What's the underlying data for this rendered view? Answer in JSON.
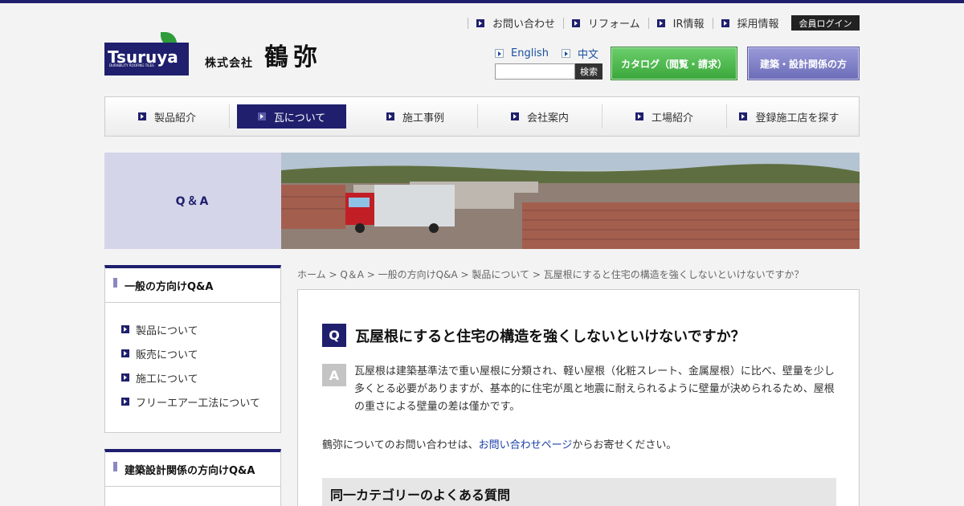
{
  "header": {
    "util_nav": [
      "お問い合わせ",
      "リフォーム",
      "IR情報",
      "採用情報"
    ],
    "login_label": "会員ログイン",
    "logo_text": "Tsuruya",
    "logo_sub": "DURABILITY ROOFING TILES",
    "corp_prefix": "株式会社",
    "corp_name": "鶴弥",
    "languages": [
      "English",
      "中文"
    ],
    "search_placeholder": "",
    "search_button": "検索",
    "catalog_button": "カタログ（閲覧・請求）",
    "pro_button": "建築・設計関係の方"
  },
  "global_nav": [
    {
      "label": "製品紹介",
      "active": false
    },
    {
      "label": "瓦について",
      "active": true
    },
    {
      "label": "施工事例",
      "active": false
    },
    {
      "label": "会社案内",
      "active": false
    },
    {
      "label": "工場紹介",
      "active": false
    },
    {
      "label": "登録施工店を探す",
      "active": false
    }
  ],
  "hero": {
    "label": "Q＆A"
  },
  "sidebar": {
    "general": {
      "title": "一般の方向けQ&A",
      "items": [
        "製品について",
        "販売について",
        "施工について",
        "フリーエアー工法について"
      ]
    },
    "pro": {
      "title": "建築設計関係の方向けQ&A"
    }
  },
  "breadcrumb": "ホーム > Q＆A > 一般の方向けQ&A > 製品について > 瓦屋根にすると住宅の構造を強くしないといけないですか？",
  "qa": {
    "q_mark": "Q",
    "question": "瓦屋根にすると住宅の構造を強くしないといけないですか？",
    "a_mark": "A",
    "answer": "瓦屋根は建築基準法で重い屋根に分類され、軽い屋根（化粧スレート、金属屋根）に比べ、壁量を少し多くとる必要がありますが、基本的に住宅が風と地震に耐えられるように壁量が決められるため、屋根の重さによる壁量の差は僅かです。",
    "contact_prefix": "鶴弥についてのお問い合わせは、",
    "contact_link": "お問い合わせページ",
    "contact_suffix": "からお寄せください。",
    "related_title": "同一カテゴリーのよくある質問"
  },
  "colors": {
    "navy": "#1f1f6e",
    "green": "#3aa63a",
    "lavender": "#d5d5ea"
  }
}
